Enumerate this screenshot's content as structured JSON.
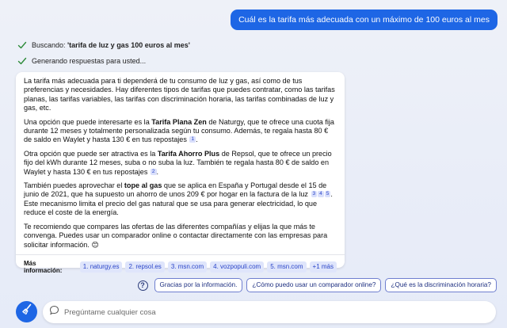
{
  "user_message": "Cuál es la tarifa más adecuada con un máximo de 100 euros al mes",
  "status": {
    "searching_prefix": "Buscando: ",
    "searching_query": "'tarifa de luz y gas 100 euros al mes'",
    "generating": "Generando respuestas para usted..."
  },
  "answer": {
    "p1": "La tarifa más adecuada para ti dependerá de tu consumo de luz y gas, así como de tus preferencias y necesidades. Hay diferentes tipos de tarifas que puedes contratar, como las tarifas planas, las tarifas variables, las tarifas con discriminación horaria, las tarifas combinadas de luz y gas, etc.",
    "p2_a": "Una opción que puede interesarte es la ",
    "p2_b": "Tarifa Plana Zen",
    "p2_c": " de Naturgy, que te ofrece una cuota fija durante 12 meses y totalmente personalizada según tu consumo. Además, te regala hasta 80 € de saldo en Waylet y hasta 130 € en tus repostajes",
    "p2_cite": "1",
    "p3_a": "Otra opción que puede ser atractiva es la ",
    "p3_b": "Tarifa Ahorro Plus",
    "p3_c": " de Repsol, que te ofrece un precio fijo del kWh durante 12 meses, suba o no suba la luz. También te regala hasta 80 € de saldo en Waylet y hasta 130 € en tus repostajes",
    "p3_cite": "2",
    "p4_a": "También puedes aprovechar el ",
    "p4_b": "tope al gas",
    "p4_c": " que se aplica en España y Portugal desde el 15 de junio de 2021, que ha supuesto un ahorro de unos 209 € por hogar en la factura de la luz",
    "p4_cites": [
      "3",
      "4",
      "5"
    ],
    "p4_d": ". Este mecanismo limita el precio del gas natural que se usa para generar electricidad, lo que reduce el coste de la energía.",
    "p5": "Te recomiendo que compares las ofertas de las diferentes compañías y elijas la que más te convenga. Puedes usar un comparador online o contactar directamente con las empresas para solicitar información.",
    "p5_emoji": "😊"
  },
  "more_info": {
    "label": "Más información:",
    "sources": [
      "1. naturgy.es",
      "2. repsol.es",
      "3. msn.com",
      "4. vozpopuli.com",
      "5. msn.com"
    ],
    "more": "+1 más"
  },
  "suggestions": [
    "Gracias por la información.",
    "¿Cómo puedo usar un comparador online?",
    "¿Qué es la discriminación horaria?"
  ],
  "help_symbol": "?",
  "input": {
    "placeholder": "Pregúntame cualquier cosa"
  },
  "colors": {
    "accent": "#1e66e5",
    "check": "#2e8b3a",
    "citation_bg": "#dfe5fb"
  }
}
